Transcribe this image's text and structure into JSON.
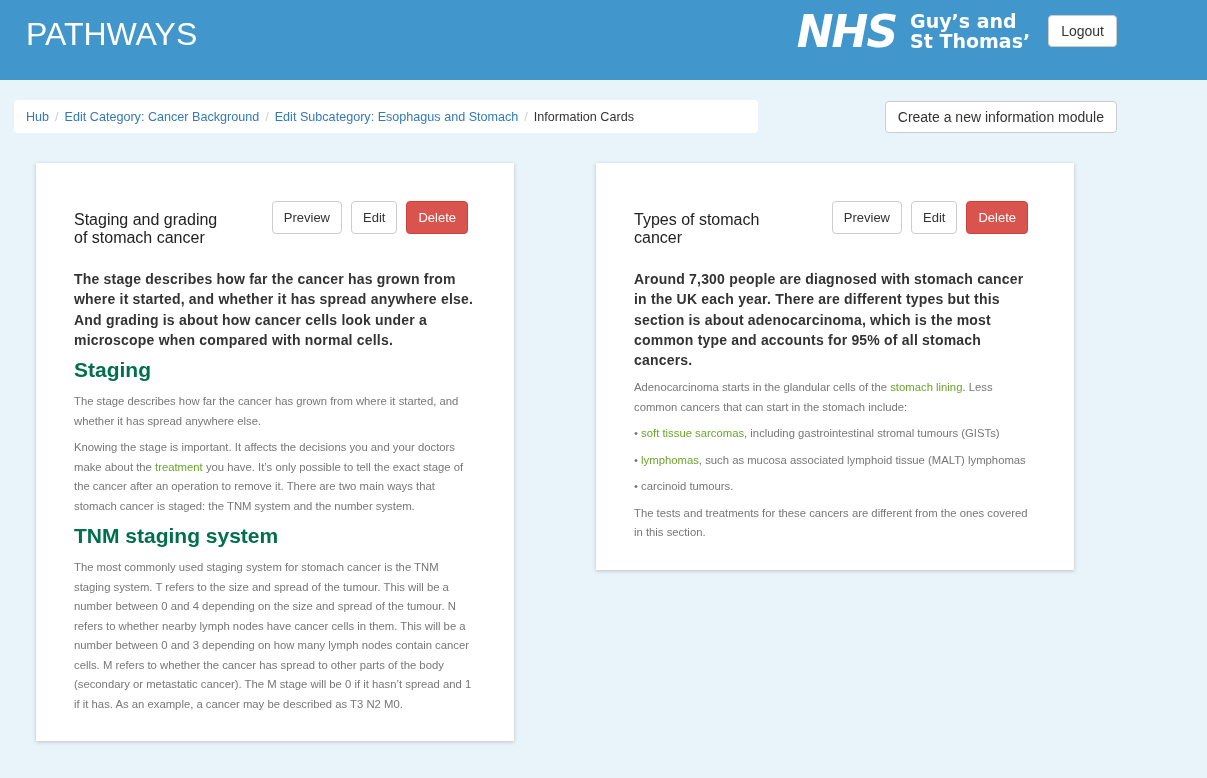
{
  "header": {
    "title": "PATHWAYS",
    "logo_mark": "NHS",
    "logo_org_lines": [
      "Guy’s and",
      "St Thomas’"
    ],
    "logout": "Logout"
  },
  "breadcrumb_separator": "/",
  "breadcrumb": [
    {
      "label": "Hub",
      "current": false
    },
    {
      "label": "Edit Category: Cancer Background",
      "current": false
    },
    {
      "label": "Edit Subcategory: Esophagus and Stomach",
      "current": false
    },
    {
      "label": "Information Cards",
      "current": true
    }
  ],
  "create_button": "Create a new information module",
  "cards": [
    {
      "title": "Staging and grading of stomach cancer",
      "actions": [
        {
          "label": "Preview",
          "kind": "default"
        },
        {
          "label": "Edit",
          "kind": "default"
        },
        {
          "label": "Delete",
          "kind": "danger"
        }
      ],
      "blocks": [
        {
          "kind": "lead",
          "segments": [
            {
              "text": "The stage describes how far the cancer has grown from where it started, and whether it has spread anywhere else. And grading is about how cancer cells look under a microscope when compared with normal cells.",
              "link": false
            }
          ]
        },
        {
          "kind": "heading",
          "segments": [
            {
              "text": "Staging",
              "link": false
            }
          ]
        },
        {
          "kind": "paragraph",
          "segments": [
            {
              "text": "The stage describes how far the cancer has grown from where it started, and whether it has spread anywhere else.",
              "link": false
            }
          ]
        },
        {
          "kind": "paragraph",
          "segments": [
            {
              "text": "Knowing the stage is important. It affects the decisions you and your doctors make about the ",
              "link": false
            },
            {
              "text": "treatment",
              "link": true
            },
            {
              "text": " you have. It’s only possible to tell the exact stage of the cancer after an operation to remove it. There are two main ways that stomach cancer is staged: the TNM system and the number system.",
              "link": false
            }
          ]
        },
        {
          "kind": "heading",
          "segments": [
            {
              "text": "TNM staging system",
              "link": false
            }
          ]
        },
        {
          "kind": "paragraph",
          "segments": [
            {
              "text": "The most commonly used staging system for stomach cancer is the TNM staging system. T refers to the size and spread of the tumour. This will be a number between 0 and 4 depending on the size and spread of the tumour. N refers to whether nearby lymph nodes have cancer cells in them. This will be a number between 0 and 3 depending on how many lymph nodes contain cancer cells. M refers to whether the cancer has spread to other parts of the body (secondary or metastatic cancer). The M stage will be 0 if it hasn’t spread and 1 if it has. As an example, a cancer may be described as T3 N2 M0.",
              "link": false
            }
          ]
        }
      ]
    },
    {
      "title": "Types of stomach cancer",
      "actions": [
        {
          "label": "Preview",
          "kind": "default"
        },
        {
          "label": "Edit",
          "kind": "default"
        },
        {
          "label": "Delete",
          "kind": "danger"
        }
      ],
      "blocks": [
        {
          "kind": "lead",
          "segments": [
            {
              "text": "Around 7,300 people are diagnosed with stomach cancer in the UK each year. There are different types but this section is about adenocarcinoma, which is the most common type and accounts for 95% of all stomach cancers.",
              "link": false
            }
          ]
        },
        {
          "kind": "paragraph",
          "segments": [
            {
              "text": "Adenocarcinoma starts in the glandular cells of the ",
              "link": false
            },
            {
              "text": "stomach lining",
              "link": true
            },
            {
              "text": ". Less common cancers that can start in the stomach include:",
              "link": false
            }
          ]
        },
        {
          "kind": "paragraph",
          "segments": [
            {
              "text": "• ",
              "link": false
            },
            {
              "text": "soft tissue sarcomas",
              "link": true
            },
            {
              "text": ", including gastrointestinal stromal tumours (GISTs)",
              "link": false
            }
          ]
        },
        {
          "kind": "paragraph",
          "segments": [
            {
              "text": "• ",
              "link": false
            },
            {
              "text": "lymphomas",
              "link": true
            },
            {
              "text": ", such as mucosa associated lymphoid tissue (MALT) lymphomas",
              "link": false
            }
          ]
        },
        {
          "kind": "paragraph",
          "segments": [
            {
              "text": "• carcinoid tumours.",
              "link": false
            }
          ]
        },
        {
          "kind": "paragraph",
          "segments": [
            {
              "text": "The tests and treatments for these cancers are different from the ones covered in this section.",
              "link": false
            }
          ]
        }
      ]
    }
  ]
}
